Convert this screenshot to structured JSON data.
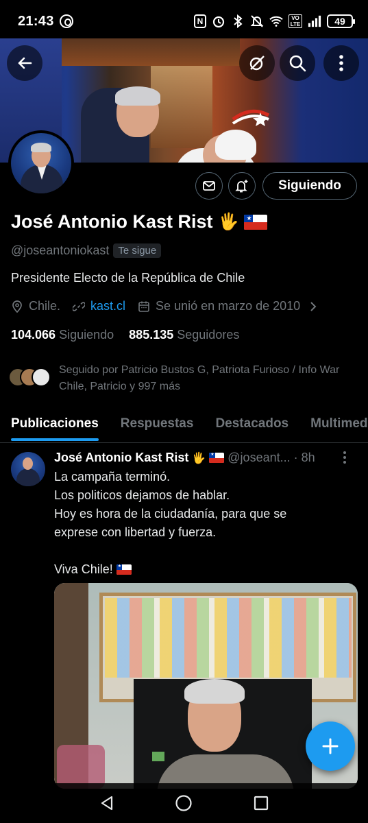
{
  "status_bar": {
    "time": "21:43",
    "icons": [
      "threads-icon",
      "nfc-icon",
      "alarm-icon",
      "bluetooth-icon",
      "mute-icon",
      "wifi-icon",
      "volte-icon",
      "signal-icon"
    ],
    "volte_label": "VO LTE",
    "battery": "49"
  },
  "header": {
    "back_icon": "back-arrow-icon",
    "grok_icon": "grok-icon",
    "search_icon": "search-icon",
    "more_icon": "more-vertical-icon"
  },
  "profile": {
    "name": "José Antonio Kast Rist",
    "handle": "@joseantoniokast",
    "follows_you": "Te sigue",
    "bio": "Presidente Electo de la República de Chile",
    "location": "Chile.",
    "link": "kast.cl",
    "joined": "Se unió en marzo de 2010",
    "following_count": "104.066",
    "following_label": "Siguiendo",
    "followers_count": "885.135",
    "followers_label": "Seguidores",
    "followed_by": "Seguido por Patricio Bustos G, Patriota Furioso / Info War Chile, Patricio y 997 más",
    "follow_button": "Siguiendo"
  },
  "tabs": [
    {
      "label": "Publicaciones",
      "active": true
    },
    {
      "label": "Respuestas",
      "active": false
    },
    {
      "label": "Destacados",
      "active": false
    },
    {
      "label": "Multimedia",
      "active": false
    }
  ],
  "tweet": {
    "author": "José Antonio Kast Rist",
    "handle": "@joseant...",
    "time": "8h",
    "lines": [
      "La campaña terminó.",
      "Los politicos dejamos de hablar.",
      "Hoy es hora de la ciudadanía, para que se",
      "exprese con libertad y fuerza.",
      "",
      "Viva Chile!"
    ]
  },
  "colors": {
    "accent": "#1d9bf0",
    "background": "#000000",
    "muted_text": "#71767b"
  }
}
